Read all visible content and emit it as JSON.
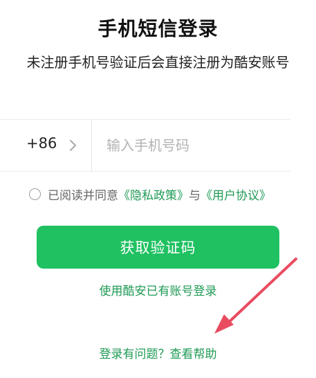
{
  "header": {
    "title": "手机短信登录",
    "subtitle": "未注册手机号验证后会直接注册为酷安账号"
  },
  "phone": {
    "country_code": "+86",
    "chevron_icon": "chevron-right-icon",
    "placeholder": "输入手机号码",
    "value": ""
  },
  "agreement": {
    "checked": false,
    "prefix": "已阅读并同意",
    "privacy_link": "《隐私政策》",
    "joiner": "与",
    "terms_link": "《用户协议》"
  },
  "actions": {
    "get_code": "获取验证码",
    "account_login": "使用酷安已有账号登录",
    "help": "登录有问题？查看帮助"
  },
  "colors": {
    "brand_green": "#1fc161",
    "link_green": "#1f9a55",
    "arrow_red": "#e94b5f"
  }
}
